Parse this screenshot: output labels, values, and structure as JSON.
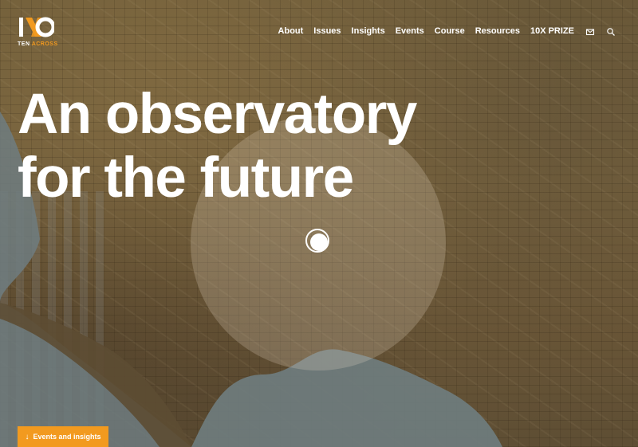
{
  "logo": {
    "word_white": "TEN",
    "word_orange": "ACROSS",
    "mark": "10"
  },
  "nav": {
    "items": [
      "About",
      "Issues",
      "Insights",
      "Events",
      "Course",
      "Resources",
      "10X PRIZE"
    ],
    "icons": [
      "mail-icon",
      "search-icon"
    ]
  },
  "hero": {
    "headline_line1": "An observatory",
    "headline_line2": "for the future"
  },
  "cta": {
    "label": "Events and insights",
    "icon": "arrow-down-icon"
  },
  "colors": {
    "accent": "#f29a1f",
    "text": "#ffffff"
  }
}
